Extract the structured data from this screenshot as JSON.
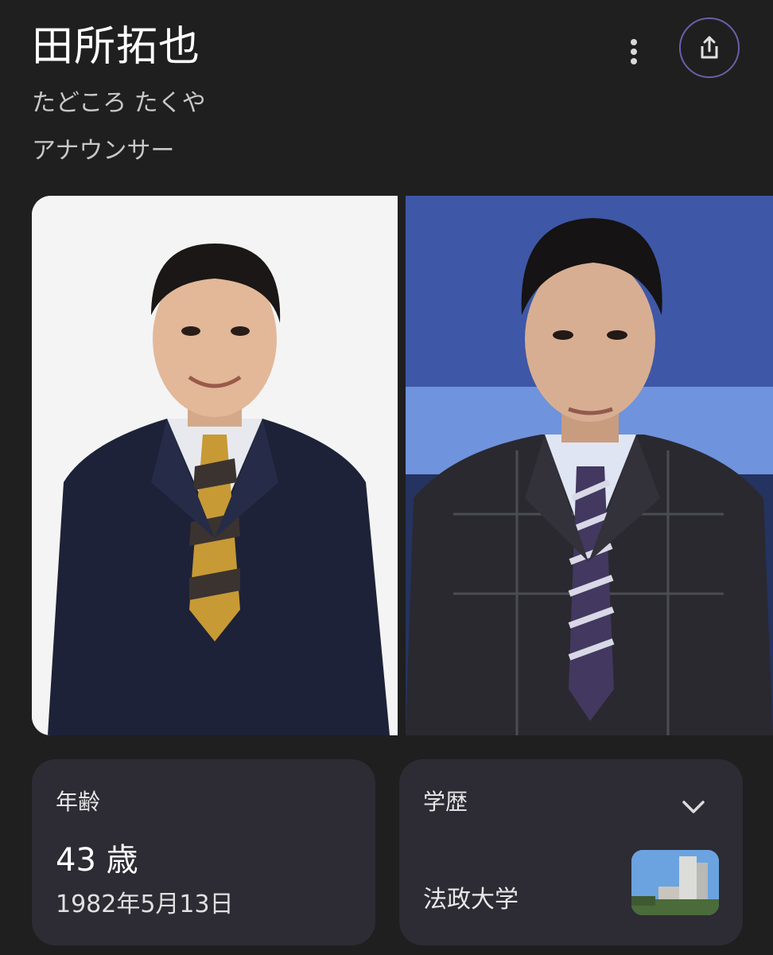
{
  "header": {
    "title": "田所拓也",
    "reading": "たどころ たくや",
    "role": "アナウンサー",
    "more_icon": "more-vert-icon",
    "share_icon": "share-icon"
  },
  "photos": [
    {
      "name": "studio-portrait-photo"
    },
    {
      "name": "news-desk-photo"
    }
  ],
  "cards": {
    "age": {
      "label": "年齢",
      "value": "43 歳",
      "birthdate": "1982年5月13日"
    },
    "education": {
      "label": "学歴",
      "value": "法政大学",
      "expand_icon": "chevron-down-icon"
    }
  },
  "colors": {
    "background": "#1f1f1f",
    "card": "#2d2b34",
    "share_ring": "#6c5fa8"
  }
}
